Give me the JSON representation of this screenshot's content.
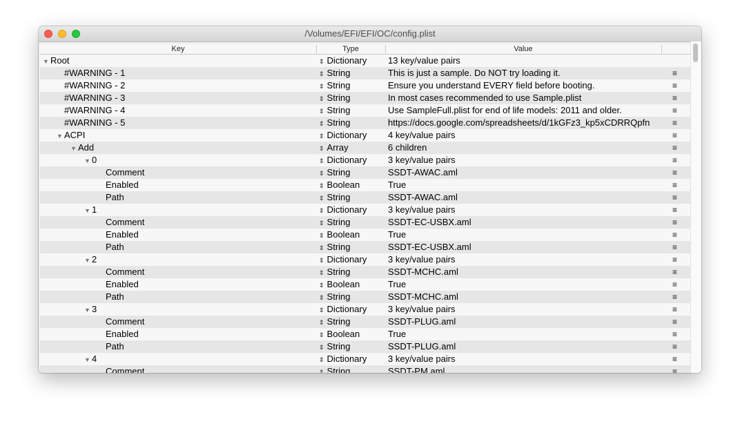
{
  "window": {
    "title": "/Volumes/EFI/EFI/OC/config.plist"
  },
  "columns": {
    "key": "Key",
    "type": "Type",
    "value": "Value"
  },
  "icons": {
    "expanded": "triangle-down-icon",
    "type_stepper": "up-down-arrows-icon",
    "row_menu": "hamburger-menu-icon"
  },
  "rows": [
    {
      "key": "Root",
      "level": 0,
      "expandable": true,
      "type": "Dictionary",
      "value": "13 key/value pairs",
      "menu": false
    },
    {
      "key": "#WARNING - 1",
      "level": 1,
      "expandable": false,
      "type": "String",
      "value": "This is just a sample. Do NOT try loading it.",
      "menu": true
    },
    {
      "key": "#WARNING - 2",
      "level": 1,
      "expandable": false,
      "type": "String",
      "value": "Ensure you understand EVERY field before booting.",
      "menu": true
    },
    {
      "key": "#WARNING - 3",
      "level": 1,
      "expandable": false,
      "type": "String",
      "value": "In most cases recommended to use Sample.plist",
      "menu": true
    },
    {
      "key": "#WARNING - 4",
      "level": 1,
      "expandable": false,
      "type": "String",
      "value": "Use SampleFull.plist for end of life models: 2011 and older.",
      "menu": true
    },
    {
      "key": "#WARNING - 5",
      "level": 1,
      "expandable": false,
      "type": "String",
      "value": "https://docs.google.com/spreadsheets/d/1kGFz3_kp5xCDRRQpfn",
      "menu": true
    },
    {
      "key": "ACPI",
      "level": 1,
      "expandable": true,
      "type": "Dictionary",
      "value": "4 key/value pairs",
      "menu": true
    },
    {
      "key": "Add",
      "level": 2,
      "expandable": true,
      "type": "Array",
      "value": "6 children",
      "menu": true
    },
    {
      "key": "0",
      "level": 3,
      "expandable": true,
      "type": "Dictionary",
      "value": "3 key/value pairs",
      "menu": true
    },
    {
      "key": "Comment",
      "level": 4,
      "expandable": false,
      "type": "String",
      "value": "SSDT-AWAC.aml",
      "menu": true
    },
    {
      "key": "Enabled",
      "level": 4,
      "expandable": false,
      "type": "Boolean",
      "value": "True",
      "menu": true
    },
    {
      "key": "Path",
      "level": 4,
      "expandable": false,
      "type": "String",
      "value": "SSDT-AWAC.aml",
      "menu": true
    },
    {
      "key": "1",
      "level": 3,
      "expandable": true,
      "type": "Dictionary",
      "value": "3 key/value pairs",
      "menu": true
    },
    {
      "key": "Comment",
      "level": 4,
      "expandable": false,
      "type": "String",
      "value": "SSDT-EC-USBX.aml",
      "menu": true
    },
    {
      "key": "Enabled",
      "level": 4,
      "expandable": false,
      "type": "Boolean",
      "value": "True",
      "menu": true
    },
    {
      "key": "Path",
      "level": 4,
      "expandable": false,
      "type": "String",
      "value": "SSDT-EC-USBX.aml",
      "menu": true
    },
    {
      "key": "2",
      "level": 3,
      "expandable": true,
      "type": "Dictionary",
      "value": "3 key/value pairs",
      "menu": true
    },
    {
      "key": "Comment",
      "level": 4,
      "expandable": false,
      "type": "String",
      "value": "SSDT-MCHC.aml",
      "menu": true
    },
    {
      "key": "Enabled",
      "level": 4,
      "expandable": false,
      "type": "Boolean",
      "value": "True",
      "menu": true
    },
    {
      "key": "Path",
      "level": 4,
      "expandable": false,
      "type": "String",
      "value": "SSDT-MCHC.aml",
      "menu": true
    },
    {
      "key": "3",
      "level": 3,
      "expandable": true,
      "type": "Dictionary",
      "value": "3 key/value pairs",
      "menu": true
    },
    {
      "key": "Comment",
      "level": 4,
      "expandable": false,
      "type": "String",
      "value": "SSDT-PLUG.aml",
      "menu": true
    },
    {
      "key": "Enabled",
      "level": 4,
      "expandable": false,
      "type": "Boolean",
      "value": "True",
      "menu": true
    },
    {
      "key": "Path",
      "level": 4,
      "expandable": false,
      "type": "String",
      "value": "SSDT-PLUG.aml",
      "menu": true
    },
    {
      "key": "4",
      "level": 3,
      "expandable": true,
      "type": "Dictionary",
      "value": "3 key/value pairs",
      "menu": true
    },
    {
      "key": "Comment",
      "level": 4,
      "expandable": false,
      "type": "String",
      "value": "SSDT-PM.aml",
      "menu": true
    }
  ]
}
